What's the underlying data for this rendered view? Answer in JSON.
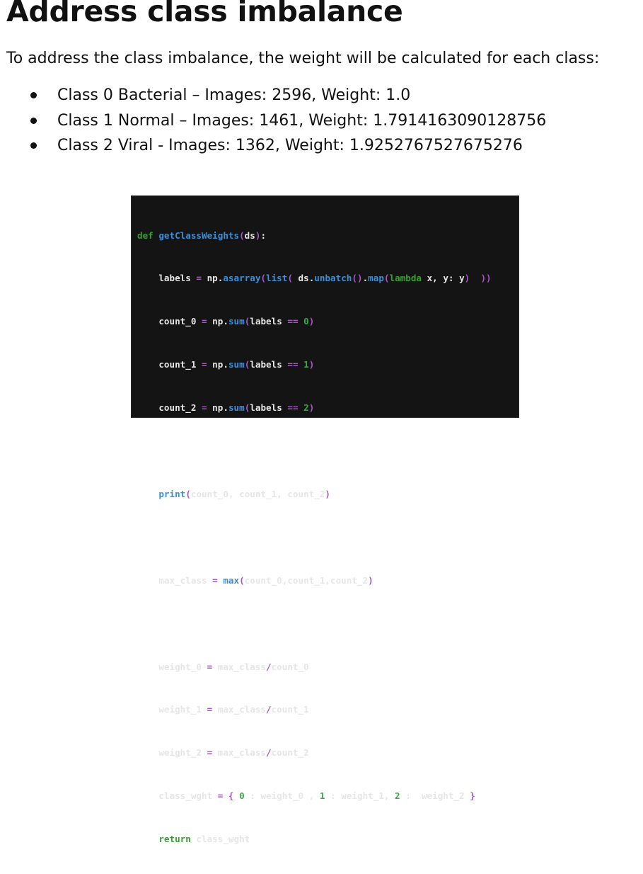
{
  "heading": "Address class imbalance",
  "intro": "To address the class imbalance, the weight will be calculated for each class:",
  "classes": [
    "Class 0 Bacterial – Images: 2596, Weight: 1.0",
    "Class 1 Normal – Images: 1461, Weight: 1.7914163090128756",
    "Class 2 Viral - Images: 1362, Weight: 1.9252767527675276"
  ],
  "code": {
    "lines": [
      "def getClassWeights(ds):",
      "    labels = np.asarray(list( ds.unbatch().map(lambda x, y: y)  ))",
      "    count_0 = np.sum(labels == 0)",
      "    count_1 = np.sum(labels == 1)",
      "    count_2 = np.sum(labels == 2)",
      "",
      "    print(count_0, count_1, count_2)",
      "",
      "    max_class = max(count_0,count_1,count_2)",
      "",
      "    weight_0 = max_class/count_0",
      "    weight_1 = max_class/count_1",
      "    weight_2 = max_class/count_2",
      "    class_wght = { 0 : weight_0 , 1 : weight_1, 2 :  weight_2 }",
      "    return class_wght"
    ]
  },
  "colors": {
    "keyword": "#37a02f",
    "function": "#3b8fd8",
    "operator": "#a955c6",
    "number": "#3aa84a",
    "code_background": "#141414"
  }
}
